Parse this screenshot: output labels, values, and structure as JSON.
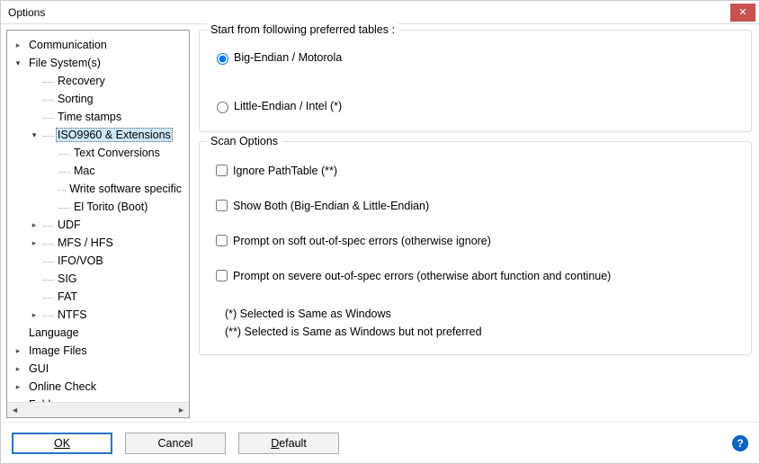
{
  "window": {
    "title": "Options"
  },
  "tree": {
    "items": [
      {
        "label": "Communication",
        "depth": 0,
        "exp": "closed"
      },
      {
        "label": "File System(s)",
        "depth": 0,
        "exp": "open"
      },
      {
        "label": "Recovery",
        "depth": 1,
        "exp": "none"
      },
      {
        "label": "Sorting",
        "depth": 1,
        "exp": "none"
      },
      {
        "label": "Time stamps",
        "depth": 1,
        "exp": "none"
      },
      {
        "label": "ISO9960 & Extensions",
        "depth": 1,
        "exp": "open",
        "selected": true
      },
      {
        "label": "Text Conversions",
        "depth": 2,
        "exp": "none"
      },
      {
        "label": "Mac",
        "depth": 2,
        "exp": "none"
      },
      {
        "label": "Write software specific",
        "depth": 2,
        "exp": "none"
      },
      {
        "label": "El Torito (Boot)",
        "depth": 2,
        "exp": "none"
      },
      {
        "label": "UDF",
        "depth": 1,
        "exp": "closed"
      },
      {
        "label": "MFS / HFS",
        "depth": 1,
        "exp": "closed"
      },
      {
        "label": "IFO/VOB",
        "depth": 1,
        "exp": "none"
      },
      {
        "label": "SIG",
        "depth": 1,
        "exp": "none"
      },
      {
        "label": "FAT",
        "depth": 1,
        "exp": "none"
      },
      {
        "label": "NTFS",
        "depth": 1,
        "exp": "closed"
      },
      {
        "label": "Language",
        "depth": 0,
        "exp": "none"
      },
      {
        "label": "Image Files",
        "depth": 0,
        "exp": "closed"
      },
      {
        "label": "GUI",
        "depth": 0,
        "exp": "closed"
      },
      {
        "label": "Online Check",
        "depth": 0,
        "exp": "closed"
      },
      {
        "label": "Folders",
        "depth": 0,
        "exp": "none"
      }
    ]
  },
  "group_tables": {
    "legend": "Start from following preferred tables :",
    "radios": [
      {
        "label": "Big-Endian / Motorola",
        "checked": true
      },
      {
        "label": "Little-Endian / Intel  (*)",
        "checked": false
      }
    ]
  },
  "group_scan": {
    "legend": "Scan Options",
    "checks": [
      {
        "label": "Ignore PathTable  (**)",
        "checked": false
      },
      {
        "label": "Show Both (Big-Endian & Little-Endian)",
        "checked": false
      },
      {
        "label": "Prompt on soft out-of-spec errors (otherwise ignore)",
        "checked": false
      },
      {
        "label": "Prompt on severe out-of-spec errors (otherwise abort function and continue)",
        "checked": false
      }
    ],
    "note1": "(*)  Selected is Same as Windows",
    "note2": "(**) Selected is Same as Windows but not preferred"
  },
  "footer": {
    "ok": "OK",
    "cancel": "Cancel",
    "default": "Default"
  }
}
